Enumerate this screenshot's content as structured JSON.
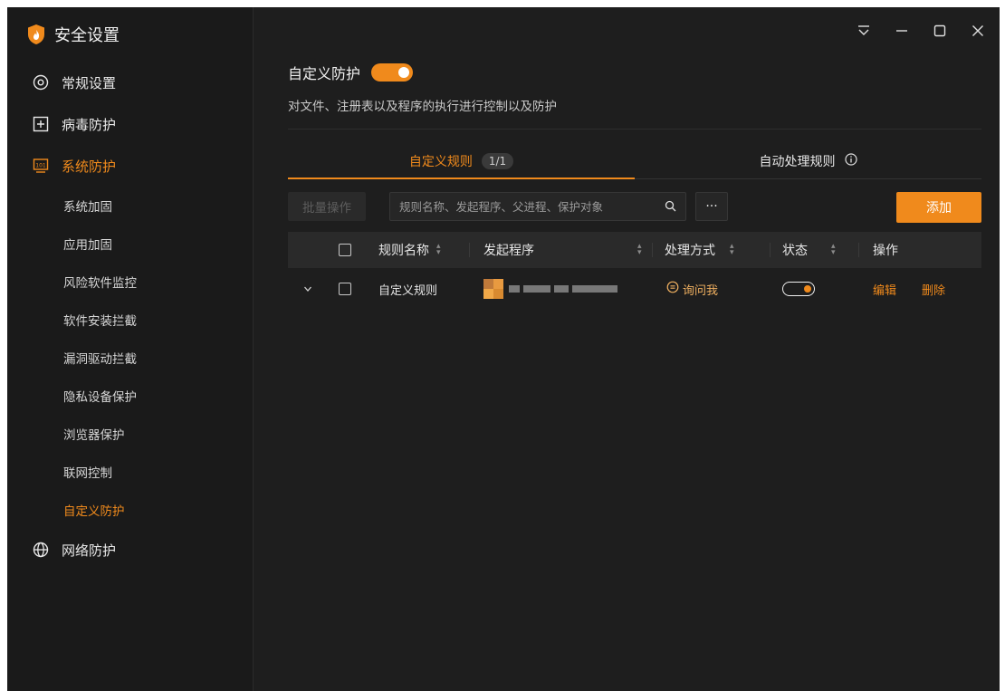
{
  "app": {
    "title": "安全设置"
  },
  "sidebar": {
    "items": [
      {
        "label": "常规设置",
        "icon": "settings-icon"
      },
      {
        "label": "病毒防护",
        "icon": "plus-box-icon"
      },
      {
        "label": "系统防护",
        "icon": "system-icon",
        "active": true
      },
      {
        "label": "网络防护",
        "icon": "globe-icon"
      }
    ],
    "sub_items": [
      {
        "label": "系统加固"
      },
      {
        "label": "应用加固"
      },
      {
        "label": "风险软件监控"
      },
      {
        "label": "软件安装拦截"
      },
      {
        "label": "漏洞驱动拦截"
      },
      {
        "label": "隐私设备保护"
      },
      {
        "label": "浏览器保护"
      },
      {
        "label": "联网控制"
      },
      {
        "label": "自定义防护",
        "active": true
      }
    ]
  },
  "main": {
    "title": "自定义防护",
    "toggle_on": true,
    "description": "对文件、注册表以及程序的执行进行控制以及防护",
    "tabs": [
      {
        "label": "自定义规则",
        "badge": "1/1",
        "active": true
      },
      {
        "label": "自动处理规则",
        "icon": "info-icon"
      }
    ],
    "toolbar": {
      "batch_label": "批量操作",
      "search_placeholder": "规则名称、发起程序、父进程、保护对象",
      "more_label": "···",
      "add_label": "添加"
    },
    "table": {
      "columns": [
        "规则名称",
        "发起程序",
        "处理方式",
        "状态",
        "操作"
      ],
      "rows": [
        {
          "name": "自定义规则",
          "process": "",
          "action": "询问我",
          "enabled": true,
          "edit_label": "编辑",
          "delete_label": "删除"
        }
      ]
    }
  },
  "colors": {
    "accent": "#f08a1c",
    "background": "#1e1e1e",
    "sidebar": "#1a1a1a"
  }
}
